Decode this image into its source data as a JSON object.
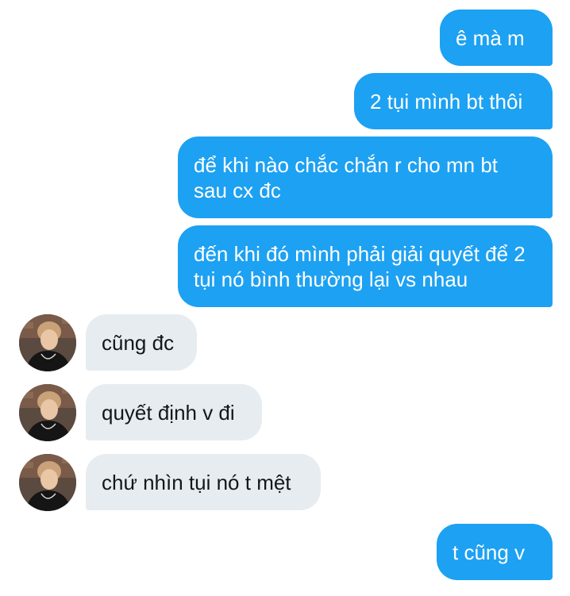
{
  "conversation": {
    "messages": [
      {
        "direction": "outgoing",
        "text": "ê mà m"
      },
      {
        "direction": "outgoing",
        "text": "2 tụi mình bt thôi"
      },
      {
        "direction": "outgoing",
        "text": "để khi nào chắc chắn r cho mn bt sau cx đc"
      },
      {
        "direction": "outgoing",
        "text": "đến khi đó mình phải giải quyết để 2 tụi nó bình thường lại vs nhau"
      },
      {
        "direction": "incoming",
        "text": "cũng đc"
      },
      {
        "direction": "incoming",
        "text": "quyết định v đi"
      },
      {
        "direction": "incoming",
        "text": "chứ nhìn tụi nó t mệt"
      },
      {
        "direction": "outgoing",
        "text": "t cũng v"
      }
    ]
  },
  "colors": {
    "outgoing_bubble": "#1da1f2",
    "incoming_bubble": "#e6ecf0",
    "outgoing_text": "#ffffff",
    "incoming_text": "#14171a"
  },
  "icons": {
    "avatar": "user-avatar-photo"
  }
}
